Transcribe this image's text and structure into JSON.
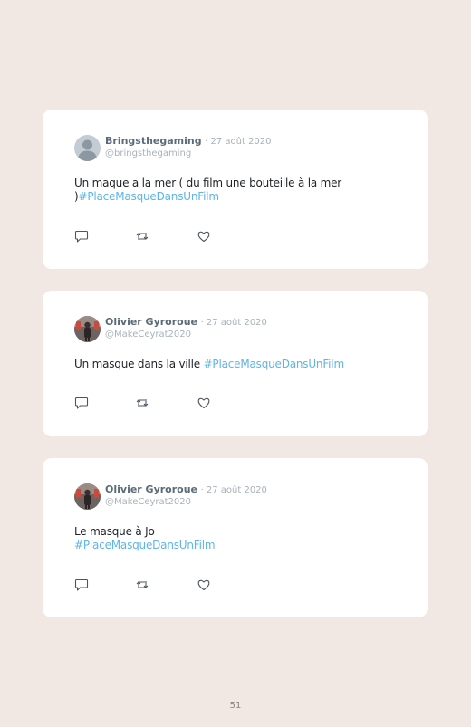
{
  "tweets": [
    {
      "author": "Bringsthegaming",
      "date": "· 27 août 2020",
      "handle": "@bringsthegaming",
      "text": "Un maque a la mer ( du film une bouteille à la mer )",
      "hashtag": "#PlaceMasqueDansUnFilm",
      "avatar_icon": "default-user-icon"
    },
    {
      "author": "Olivier Gyroroue",
      "date": "· 27 août 2020",
      "handle": "@MakeCeyrat2020",
      "text": "Un masque dans la ville ",
      "hashtag": "#PlaceMasqueDansUnFilm",
      "avatar_icon": "profile-photo"
    },
    {
      "author": "Olivier Gyroroue",
      "date": "· 27 août 2020",
      "handle": "@MakeCeyrat2020",
      "text": "Le masque à Jo",
      "hashtag": "#PlaceMasqueDansUnFilm",
      "avatar_icon": "profile-photo"
    }
  ],
  "actions": [
    "reply-icon",
    "retweet-icon",
    "like-icon"
  ],
  "page_number": "51",
  "colors": {
    "background": "#f1e8e4",
    "card": "#ffffff",
    "hashtag": "#5fb4e8",
    "meta": "#a8b2ba"
  }
}
